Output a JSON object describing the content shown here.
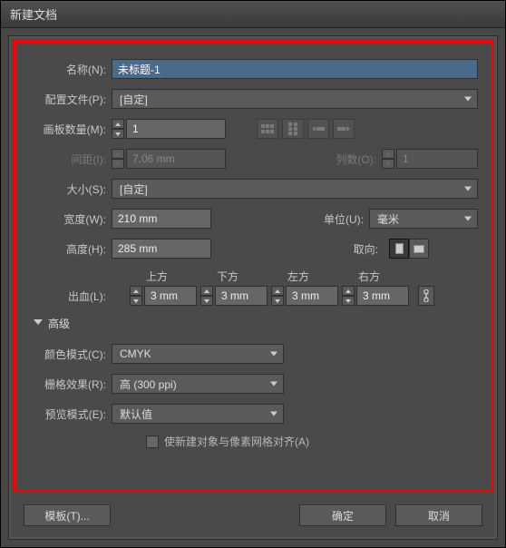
{
  "window": {
    "title": "新建文档"
  },
  "name": {
    "label": "名称(N):",
    "value": "未标题-1"
  },
  "profile": {
    "label": "配置文件(P):",
    "value": "[自定]"
  },
  "artboards": {
    "count_label": "画板数量(M):",
    "count_value": "1",
    "spacing_label": "间距(I):",
    "spacing_value": "7.06 mm",
    "cols_label": "列数(O):",
    "cols_value": "1"
  },
  "size": {
    "label": "大小(S):",
    "value": "[自定]"
  },
  "width": {
    "label": "宽度(W):",
    "value": "210 mm"
  },
  "height": {
    "label": "高度(H):",
    "value": "285 mm"
  },
  "units": {
    "label": "单位(U):",
    "value": "毫米"
  },
  "orient": {
    "label": "取向:"
  },
  "bleed": {
    "label": "出血(L):",
    "headers": {
      "top": "上方",
      "bottom": "下方",
      "left": "左方",
      "right": "右方"
    },
    "top": "3 mm",
    "bottom": "3 mm",
    "left": "3 mm",
    "right": "3 mm"
  },
  "advanced": {
    "title": "高级"
  },
  "color_mode": {
    "label": "颜色模式(C):",
    "value": "CMYK"
  },
  "raster": {
    "label": "栅格效果(R):",
    "value": "高 (300 ppi)"
  },
  "preview": {
    "label": "预览模式(E):",
    "value": "默认值"
  },
  "align_pixel": {
    "label": "使新建对象与像素网格对齐(A)"
  },
  "footer": {
    "templates": "模板(T)...",
    "ok": "确定",
    "cancel": "取消"
  }
}
